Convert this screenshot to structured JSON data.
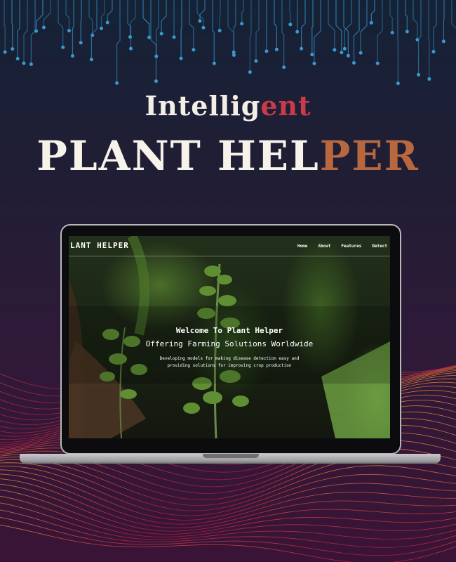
{
  "poster": {
    "headline_line1_main": "Intellig",
    "headline_line1_accent": "ent",
    "headline_line2_main": "PLANT HEL",
    "headline_line2_accent": "PER"
  },
  "website": {
    "logo": "LANT HELPER",
    "nav": [
      "Home",
      "About",
      "Features",
      "Detect"
    ],
    "hero_title": "Welcome To Plant Helper",
    "hero_subtitle": "Offering Farming Solutions Worldwide",
    "hero_description_line1": "Developing models for making disease detection easy and",
    "hero_description_line2": "providing solutions for improving crop production"
  },
  "colors": {
    "headline_accent_1": "#c93a4a",
    "headline_accent_2": "#b8683e",
    "circuit": "#2f7fb0",
    "wave_orange": "#ff8a3a",
    "wave_red": "#e2304a"
  }
}
